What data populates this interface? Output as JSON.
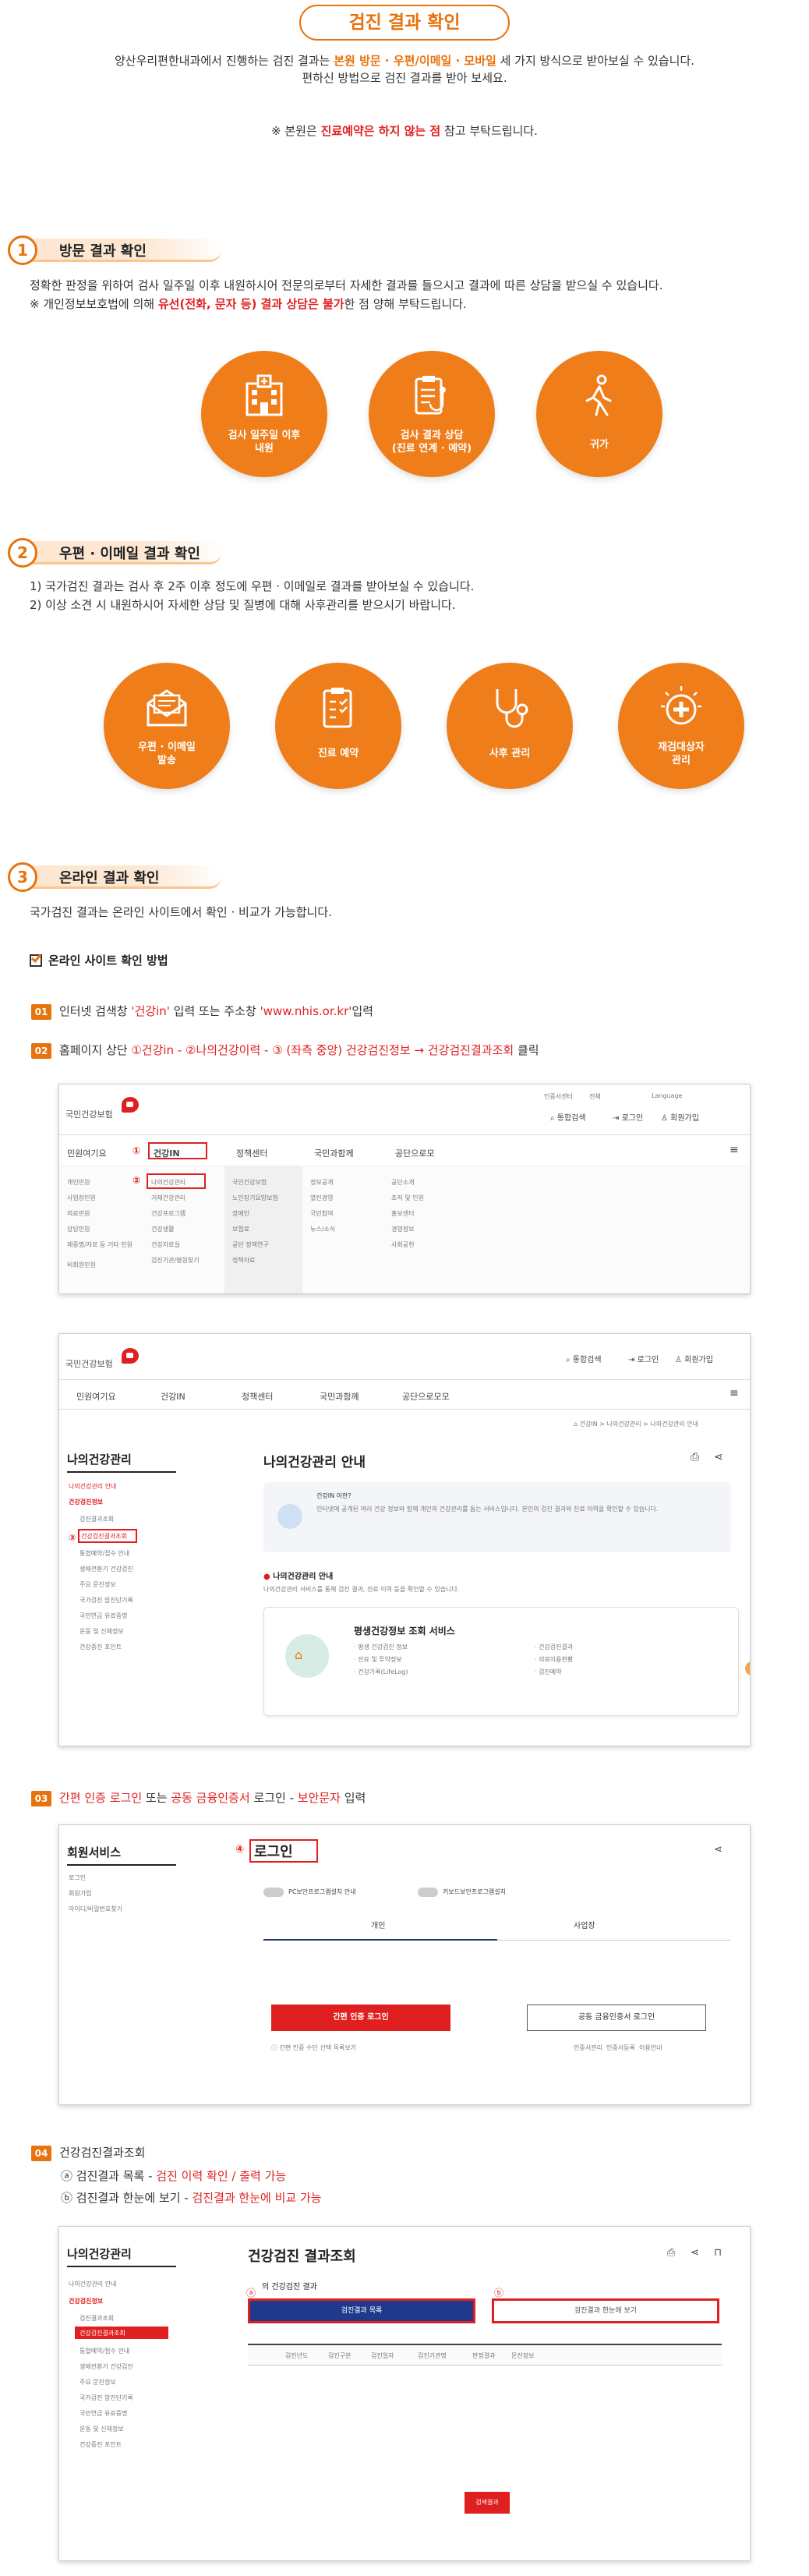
{
  "title": "검진 결과 확인",
  "intro": {
    "line1_a": "양산우리편한내과에서 진행하는 검진 결과는 ",
    "line1_b": "본원 방문 · 우편/이메일 · 모바일",
    "line1_c": " 세 가지 방식으로 받아보실 수 있습니다.",
    "line2": "편하신 방법으로 검진 결과를 받아 보세요.",
    "note_a": "※ 본원은 ",
    "note_b": "진료예약은 하지 않는 점",
    "note_c": " 참고 부탁드립니다."
  },
  "sec1": {
    "num": "1",
    "label": "방문 결과 확인",
    "p1": "정확한 판정을 위하여 검사 일주일 이후 내원하시어 전문의로부터 자세한 결과를 들으시고 결과에 따른 상담을 받으실 수 있습니다.",
    "p2_a": "※ 개인정보보호법에 의해 ",
    "p2_b": "유선(전화, 문자 등) 결과 상담은 불가",
    "p2_c": "한 점 양해 부탁드립니다.",
    "circles": [
      {
        "label1": "검사 일주일 이후",
        "label2": "내원",
        "icon": "hospital-icon"
      },
      {
        "label1": "검사 결과 상담",
        "label2": "(진료 연계 · 예약)",
        "icon": "clipboard-stethoscope-icon"
      },
      {
        "label1": "귀가",
        "label2": "",
        "icon": "walking-person-icon"
      }
    ]
  },
  "sec2": {
    "num": "2",
    "label": "우편 · 이메일 결과 확인",
    "p1": "1) 국가검진 결과는 검사 후 2주 이후 정도에 우편 · 이메일로 결과를 받아보실 수 있습니다.",
    "p2": "2) 이상 소견 시 내원하시어 자세한 상담 및 질병에 대해 사후관리를 받으시기 바랍니다.",
    "circles": [
      {
        "label1": "우편 · 이메일",
        "label2": "발송",
        "icon": "envelope-icon"
      },
      {
        "label1": "진료 예약",
        "label2": "",
        "icon": "clipboard-icon"
      },
      {
        "label1": "사후 관리",
        "label2": "",
        "icon": "stethoscope-icon"
      },
      {
        "label1": "재검대상자",
        "label2": "관리",
        "icon": "medical-cross-icon"
      }
    ]
  },
  "sec3": {
    "num": "3",
    "label": "온라인 결과 확인",
    "p1": "국가검진 결과는 온라인 사이트에서 확인 · 비교가 가능합니다.",
    "method": "온라인 사이트 확인 방법",
    "steps": [
      {
        "num": "01",
        "a": "인터넷 검색창 ",
        "b": "'건강in'",
        "c": " 입력 또는 주소창 ",
        "d": "'www.nhis.or.kr'",
        "e": "입력"
      },
      {
        "num": "02",
        "a": "홈페이지 상단 ",
        "b": "①건강in - ②나의건강이력 - ③ (좌측 중앙) 건강검진정보 → 건강검진결과조회",
        "c": " 클릭"
      },
      {
        "num": "03",
        "a": "간편 인증 로그인",
        "b": " 또는 ",
        "c": "공동 금융인증서",
        "d": " 로그인 - ",
        "e": "보안문자",
        "f": " 입력"
      },
      {
        "num": "04",
        "a": "건강검진결과조회"
      }
    ],
    "step4_items": [
      {
        "a": "ⓐ 검진결과 목록 - ",
        "b": "검진 이력 확인 / 출력 가능"
      },
      {
        "a": "ⓑ 검진결과 한눈에 보기 - ",
        "b": "검진결과 한눈에 비교 가능"
      }
    ]
  },
  "shot1": {
    "logo": "국민건강보험",
    "util": [
      "인증서센터",
      "전체",
      "Language"
    ],
    "actions": [
      "통합검색",
      "로그인",
      "회원가입"
    ],
    "nav": [
      "민원여기요",
      "건강IN",
      "정책센터",
      "국민과함께",
      "공단으로모"
    ],
    "col1": [
      "개인민원",
      "사업장민원",
      "의료민원",
      "상담민원",
      "제증명/자료 등 기타 민원",
      "비회원민원"
    ],
    "col2": [
      "나의건강관리",
      "거제건강관리",
      "건강프로그램",
      "건강생활",
      "건강자료실",
      "검진기관/병원찾기"
    ],
    "col3": [
      "국민건강보험",
      "노인장기요양보험",
      "장애인",
      "보험료",
      "공단 정책연구",
      "정책자료"
    ],
    "col4": [
      "정보공개",
      "열린경영",
      "국민참여",
      "뉴스/소식"
    ],
    "col5": [
      "공단소개",
      "조직 및 인원",
      "홍보센터",
      "경영정보",
      "사회공헌"
    ],
    "m1": "①",
    "m2": "②"
  },
  "shot2": {
    "logo": "국민건강보험",
    "actions": [
      "통합검색",
      "로그인",
      "회원가입"
    ],
    "nav": [
      "민원여기요",
      "건강IN",
      "정책센터",
      "국민과함께",
      "공단으로모모"
    ],
    "breadcrumb": "건강IN > 나의건강관리 > 나의건강관리 안내",
    "side_title": "나의건강관리",
    "side": [
      "나의건강관리 안내",
      "건강검진정보",
      "검진결과조회",
      "건강검진결과조회",
      "통합예약/접수 안내",
      "생애전환기 건강검진",
      "주요 문진정보",
      "국가검진 암진단기록",
      "국민연금 유료증명",
      "운동 및 신체정보",
      "건강증진 포인트"
    ],
    "main_title": "나의건강관리 안내",
    "info_title": "건강IN 이란?",
    "info_text": "인터넷에 공개된 여러 건강 정보와 함께 개인의 건강관리를 돕는 서비스입니다. 본인의 검진 결과와 진료 이력을 확인할 수 있습니다.",
    "sub_title": "나의건강관리 안내",
    "sub_text": "나의건강관리 서비스를 통해 검진 결과, 진료 이력 등을 확인할 수 있습니다.",
    "card_title": "평생건강정보 조회 서비스",
    "card_items": [
      "· 평생 건강검진 정보",
      "· 진료 및 투약정보",
      "· 건강기록(LifeLog)",
      "· 건강검진결과",
      "· 의료이용현황",
      "· 검진예약"
    ],
    "m3": "③"
  },
  "shot3": {
    "side_title": "회원서비스",
    "side": [
      "로그인",
      "회원가입",
      "아이디/비밀번호찾기"
    ],
    "title": "로그인",
    "m4": "④",
    "opt1": "PC보안프로그램설치 안내",
    "opt2": "키보드보안프로그램설치",
    "tab1": "개인",
    "tab2": "사업장",
    "btn1": "간편 인증 로그인",
    "btn2": "공동 금융인증서 로그인",
    "note": "간편 인증 수단 선택 목록보기",
    "links": [
      "인증서관리",
      "인증서등록",
      "이용안내"
    ]
  },
  "shot4": {
    "side_title": "나의건강관리",
    "side": [
      "나의건강관리 안내",
      "건강검진정보",
      "검진결과조회",
      "건강검진결과조회",
      "통합예약/접수 안내",
      "생애전환기 건강검진",
      "주요 문진정보",
      "국가검진 암진단기록",
      "국민연금 유료증명",
      "운동 및 신체정보",
      "건강증진 포인트"
    ],
    "title": "건강검진 결과조회",
    "subtitle": "의 건강검진 결과",
    "ma": "ⓐ",
    "mb": "ⓑ",
    "btn_a": "검진결과 목록",
    "btn_b": "검진결과 한눈에 보기",
    "cols": [
      "검진년도",
      "검진구분",
      "검진일자",
      "검진기관명",
      "판정결과",
      "문진정보"
    ],
    "btn_c": "검색결과"
  },
  "colors": {
    "orange": "#e8720c",
    "red": "#e02020"
  }
}
